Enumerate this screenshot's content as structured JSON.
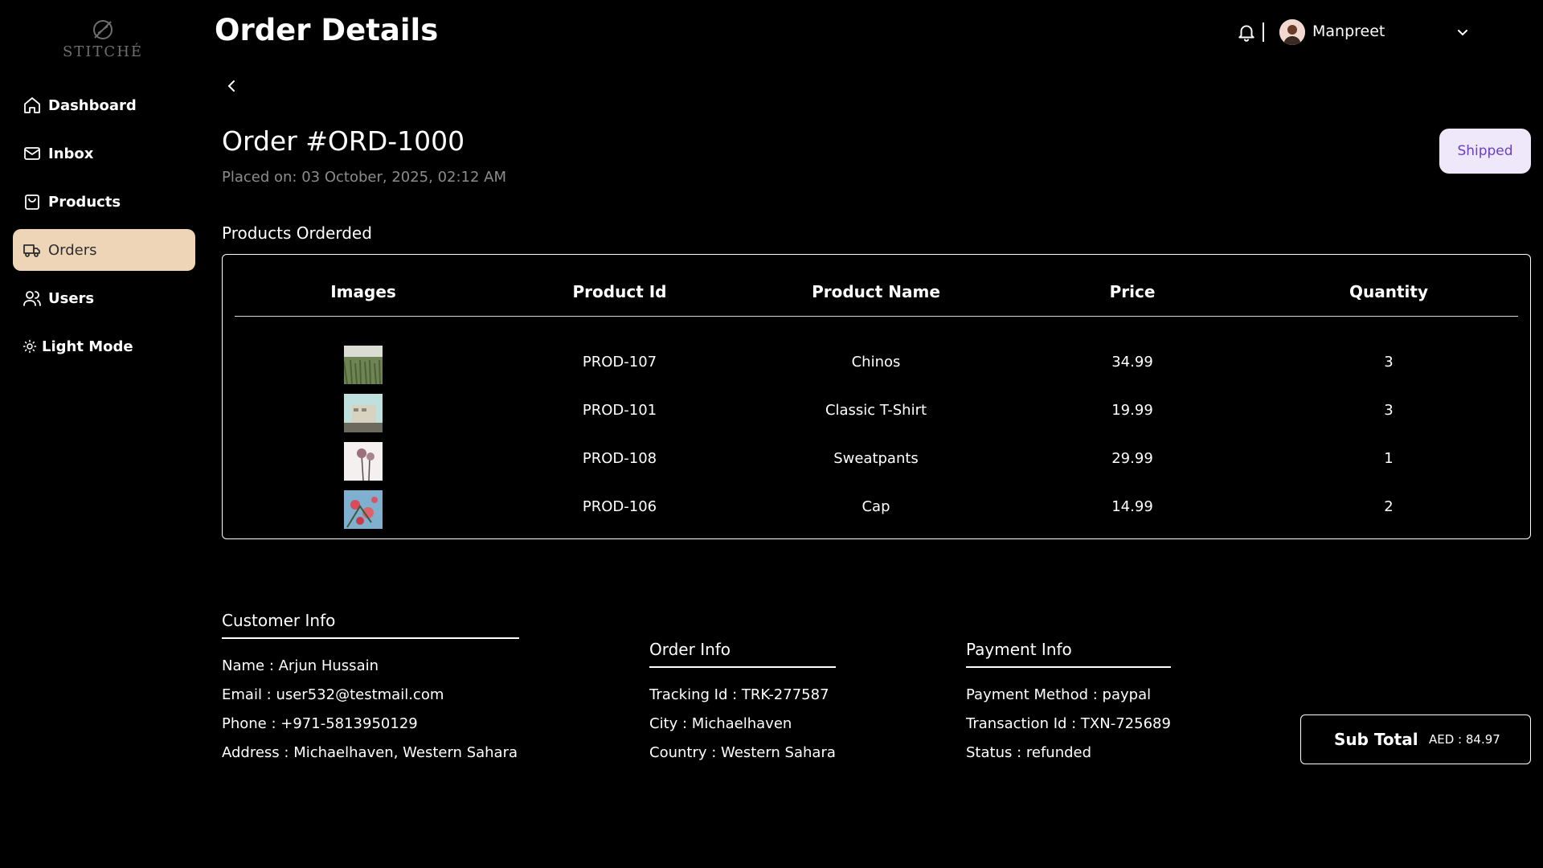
{
  "brand": {
    "name": "STITCHÉ"
  },
  "sidebar": {
    "items": [
      {
        "label": "Dashboard",
        "icon": "home-icon"
      },
      {
        "label": "Inbox",
        "icon": "mail-icon"
      },
      {
        "label": "Products",
        "icon": "shopping-bag-icon"
      },
      {
        "label": "Orders",
        "icon": "truck-icon",
        "active": true
      },
      {
        "label": "Users",
        "icon": "users-icon"
      },
      {
        "label": "Light Mode",
        "icon": "sun-icon"
      }
    ]
  },
  "header": {
    "title": "Order Details",
    "user_name": "Manpreet"
  },
  "order": {
    "title": "Order #ORD-1000",
    "placed_on": "Placed on: 03 October, 2025, 02:12 AM",
    "status": "Shipped",
    "status_color": "#6b3fc6",
    "status_bg": "#efe8fb"
  },
  "products": {
    "heading": "Products Orderded",
    "columns": [
      "Images",
      "Product Id",
      "Product Name",
      "Price",
      "Quantity"
    ],
    "rows": [
      {
        "id": "PROD-107",
        "name": "Chinos",
        "price": "34.99",
        "qty": "3",
        "image": "grass-field-thumbnail"
      },
      {
        "id": "PROD-101",
        "name": "Classic T-Shirt",
        "price": "19.99",
        "qty": "3",
        "image": "building-sky-thumbnail"
      },
      {
        "id": "PROD-108",
        "name": "Sweatpants",
        "price": "29.99",
        "qty": "1",
        "image": "palm-trees-thumbnail"
      },
      {
        "id": "PROD-106",
        "name": "Cap",
        "price": "14.99",
        "qty": "2",
        "image": "pink-flowers-thumbnail"
      }
    ]
  },
  "customer_info": {
    "heading": "Customer Info",
    "name": "Name : Arjun Hussain",
    "email": "Email : user532@testmail.com",
    "phone": "Phone : +971-5813950129",
    "address": "Address : Michaelhaven, Western Sahara"
  },
  "order_info": {
    "heading": "Order Info",
    "tracking": "Tracking Id : TRK-277587",
    "city": "City : Michaelhaven",
    "country": "Country : Western Sahara"
  },
  "payment_info": {
    "heading": "Payment Info",
    "method": "Payment Method : paypal",
    "transaction": "Transaction Id : TXN-725689",
    "status": "Status : refunded"
  },
  "subtotal": {
    "label": "Sub Total",
    "value": "AED : 84.97"
  },
  "colors": {
    "background": "#000000",
    "active_nav": "#efd5b7",
    "muted_text": "#8c8c8c"
  }
}
